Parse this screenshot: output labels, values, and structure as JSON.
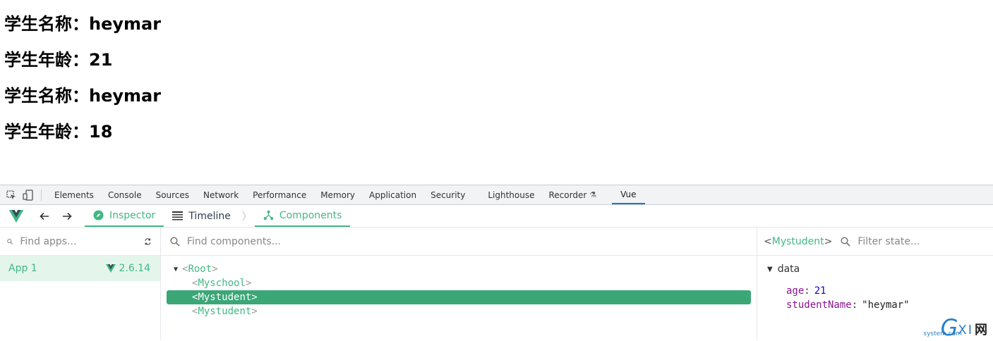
{
  "page": {
    "lines": [
      {
        "label": "学生名称：",
        "value": "heymar"
      },
      {
        "label": "学生年龄：",
        "value": "21"
      },
      {
        "label": "学生名称：",
        "value": "heymar"
      },
      {
        "label": "学生年龄：",
        "value": "18"
      }
    ]
  },
  "devtools": {
    "tabs": [
      "Elements",
      "Console",
      "Sources",
      "Network",
      "Performance",
      "Memory",
      "Application",
      "Security",
      "Lighthouse",
      "Recorder",
      "Vue"
    ],
    "active_tab": "Vue"
  },
  "vue": {
    "tabs": {
      "inspector": "Inspector",
      "timeline": "Timeline",
      "components": "Components"
    },
    "apps": {
      "search_placeholder": "Find apps...",
      "items": [
        {
          "name": "App 1",
          "version": "2.6.14"
        }
      ]
    },
    "tree": {
      "search_placeholder": "Find components...",
      "root": "Root",
      "children": [
        "Myschool",
        "Mystudent",
        "Mystudent"
      ],
      "selected_index": 1
    },
    "state": {
      "component": "Mystudent",
      "filter_placeholder": "Filter state...",
      "section": "data",
      "props": [
        {
          "key": "age",
          "value": "21",
          "type": "number"
        },
        {
          "key": "studentName",
          "value": "\"heymar\"",
          "type": "string"
        }
      ]
    },
    "colors": {
      "accent": "#42b883",
      "selected_row": "#3ba776",
      "app_row_bg": "#e4f5ec"
    }
  },
  "watermark": {
    "g": "G",
    "xi": "XI",
    "wang": "网",
    "sub": "system.com"
  }
}
